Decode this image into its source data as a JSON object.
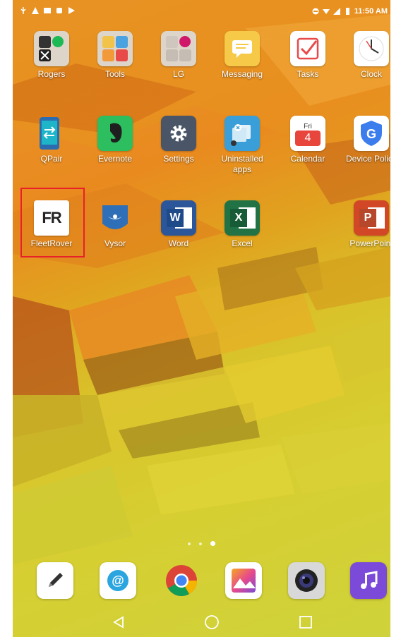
{
  "status_bar": {
    "time": "11:50 AM"
  },
  "apps": [
    {
      "id": "rogers",
      "label": "Rogers"
    },
    {
      "id": "tools",
      "label": "Tools"
    },
    {
      "id": "lg",
      "label": "LG"
    },
    {
      "id": "messaging",
      "label": "Messaging"
    },
    {
      "id": "tasks",
      "label": "Tasks"
    },
    {
      "id": "clock",
      "label": "Clock"
    },
    {
      "id": "qpair",
      "label": "QPair"
    },
    {
      "id": "evernote",
      "label": "Evernote"
    },
    {
      "id": "settings",
      "label": "Settings"
    },
    {
      "id": "uninstalled",
      "label_line1": "Uninstalled",
      "label_line2": "apps"
    },
    {
      "id": "calendar",
      "label": "Calendar",
      "day": "Fri",
      "date": "4"
    },
    {
      "id": "device-policy",
      "label": "Device Policy"
    },
    {
      "id": "fleetrover",
      "label": "FleetRover",
      "badge": "FR"
    },
    {
      "id": "vysor",
      "label": "Vysor"
    },
    {
      "id": "word",
      "label": "Word",
      "letter": "W"
    },
    {
      "id": "excel",
      "label": "Excel",
      "letter": "X"
    },
    {
      "id": "powerpoint",
      "label": "PowerPoint",
      "letter": "P"
    }
  ],
  "dock": [
    "notes",
    "email",
    "chrome",
    "gallery",
    "camera",
    "music"
  ],
  "pager": {
    "pages": 3,
    "current": 3
  },
  "nav": [
    "back",
    "home",
    "recents"
  ],
  "colors": {
    "highlight": "#e8202a",
    "accent_orange": "#e98a1f",
    "accent_yellow": "#d6cf32"
  }
}
